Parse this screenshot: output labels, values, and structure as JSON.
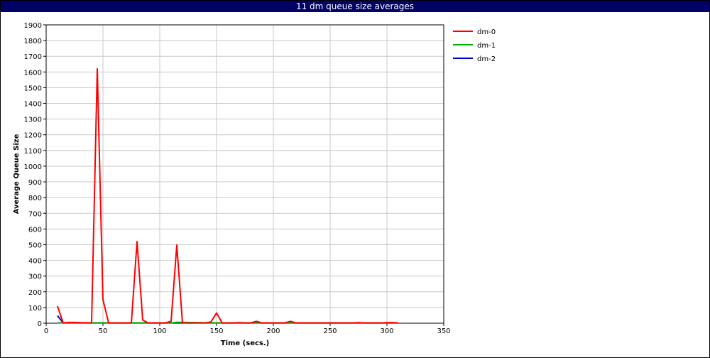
{
  "window": {
    "title": "11 dm queue size averages"
  },
  "colors": {
    "titlebar_bg": "#000066",
    "grid": "#c8c8c8"
  },
  "chart_data": {
    "type": "line",
    "title": "11 dm queue size averages",
    "xlabel": "Time (secs.)",
    "ylabel": "Average Queue Size",
    "xlim": [
      0,
      350
    ],
    "ylim": [
      0,
      1900
    ],
    "xticks": [
      0,
      50,
      100,
      150,
      200,
      250,
      300,
      350
    ],
    "yticks": [
      0,
      100,
      200,
      300,
      400,
      500,
      600,
      700,
      800,
      900,
      1000,
      1100,
      1200,
      1300,
      1400,
      1500,
      1600,
      1700,
      1800,
      1900
    ],
    "grid": true,
    "legend_position": "right",
    "series": [
      {
        "name": "dm-0",
        "color": "#ff0000",
        "x": [
          10,
          15,
          20,
          25,
          30,
          35,
          40,
          45,
          50,
          55,
          60,
          65,
          70,
          75,
          80,
          85,
          90,
          95,
          100,
          105,
          110,
          115,
          120,
          125,
          130,
          135,
          140,
          145,
          150,
          155,
          160,
          165,
          170,
          175,
          180,
          185,
          190,
          195,
          200,
          205,
          210,
          215,
          220,
          225,
          230,
          235,
          240,
          245,
          250,
          255,
          260,
          265,
          270,
          275,
          280,
          285,
          290,
          295,
          300,
          305,
          310
        ],
        "y": [
          108,
          2,
          5,
          5,
          3,
          3,
          2,
          1620,
          150,
          2,
          2,
          2,
          2,
          2,
          520,
          20,
          2,
          2,
          2,
          2,
          12,
          498,
          2,
          2,
          2,
          2,
          2,
          8,
          65,
          2,
          2,
          2,
          4,
          2,
          2,
          12,
          2,
          2,
          2,
          2,
          2,
          12,
          2,
          2,
          2,
          2,
          2,
          2,
          2,
          2,
          2,
          2,
          2,
          4,
          2,
          2,
          2,
          2,
          4,
          4,
          2
        ]
      },
      {
        "name": "dm-1",
        "color": "#00aa00",
        "x": [
          10,
          15,
          20,
          50,
          100,
          110,
          115,
          150,
          200,
          250,
          300,
          310
        ],
        "y": [
          2,
          2,
          2,
          2,
          2,
          2,
          6,
          2,
          2,
          2,
          2,
          2
        ]
      },
      {
        "name": "dm-2",
        "color": "#0000cc",
        "x": [
          10,
          15,
          20,
          50,
          100,
          150,
          200,
          250,
          300,
          310
        ],
        "y": [
          48,
          2,
          2,
          2,
          2,
          2,
          2,
          2,
          2,
          2
        ]
      }
    ]
  }
}
